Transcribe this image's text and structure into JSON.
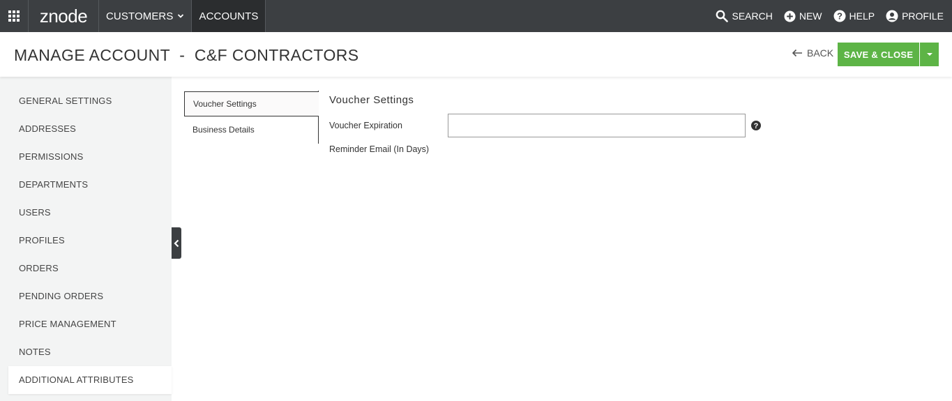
{
  "topnav": {
    "logo": "znode",
    "items": [
      {
        "label": "CUSTOMERS"
      },
      {
        "label": "ACCOUNTS"
      }
    ],
    "actions": {
      "search": "SEARCH",
      "new": "NEW",
      "help": "HELP",
      "profile": "PROFILE"
    }
  },
  "header": {
    "title": "MANAGE ACCOUNT  -  C&F CONTRACTORS",
    "back": "BACK",
    "save_close": "SAVE & CLOSE"
  },
  "sidebar": {
    "items": [
      {
        "label": "GENERAL SETTINGS"
      },
      {
        "label": "ADDRESSES"
      },
      {
        "label": "PERMISSIONS"
      },
      {
        "label": "DEPARTMENTS"
      },
      {
        "label": "USERS"
      },
      {
        "label": "PROFILES"
      },
      {
        "label": "ORDERS"
      },
      {
        "label": "PENDING ORDERS"
      },
      {
        "label": "PRICE MANAGEMENT"
      },
      {
        "label": "NOTES"
      },
      {
        "label": "ADDITIONAL ATTRIBUTES"
      }
    ],
    "active_index": 10
  },
  "subtabs": [
    {
      "label": "Voucher Settings"
    },
    {
      "label": "Business Details"
    }
  ],
  "content": {
    "section_title": "Voucher Settings",
    "voucher_expiration_label": "Voucher Expiration",
    "voucher_expiration_value": "",
    "reminder_label": "Reminder Email (In Days)"
  },
  "colors": {
    "nav_bg": "#3c3f42",
    "accent_green": "#5db446",
    "sidebar_bg": "#f3f4f4"
  }
}
